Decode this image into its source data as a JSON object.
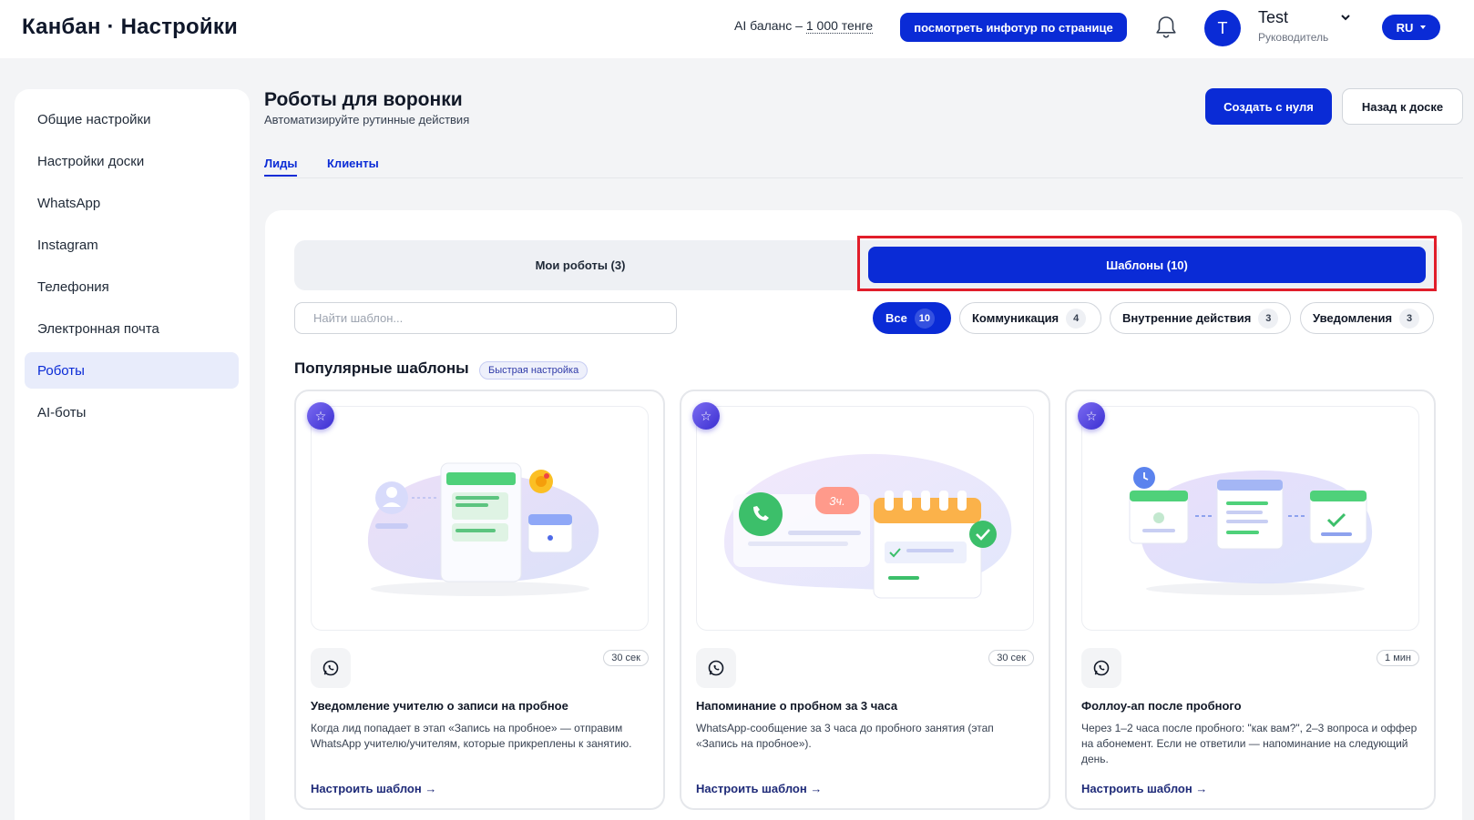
{
  "header": {
    "app_title": "Канбан · Настройки",
    "ai_balance_label": "AI баланс – ",
    "ai_balance_amount": "1 000 тенге",
    "tour_button": "посмотреть инфотур по странице",
    "avatar_letter": "T",
    "user_name": "Test",
    "user_role": "Руководитель",
    "language": "RU"
  },
  "sidebar": {
    "items": [
      {
        "label": "Общие настройки",
        "active": false
      },
      {
        "label": "Настройки доски",
        "active": false
      },
      {
        "label": "WhatsApp",
        "active": false
      },
      {
        "label": "Instagram",
        "active": false
      },
      {
        "label": "Телефония",
        "active": false
      },
      {
        "label": "Электронная почта",
        "active": false
      },
      {
        "label": "Роботы",
        "active": true
      },
      {
        "label": "AI-боты",
        "active": false
      }
    ]
  },
  "page": {
    "title": "Роботы для воронки",
    "subtitle": "Автоматизируйте рутинные действия",
    "create_button": "Создать с нуля",
    "back_button": "Назад к доске",
    "tabs": [
      {
        "label": "Лиды",
        "active": true
      },
      {
        "label": "Клиенты",
        "active": false
      }
    ]
  },
  "segment": {
    "my_robots": "Мои роботы (3)",
    "templates": "Шаблоны (10)",
    "selected": "templates"
  },
  "search": {
    "placeholder": "Найти шаблон...",
    "value": ""
  },
  "filters": [
    {
      "label": "Все",
      "count": "10",
      "active": true
    },
    {
      "label": "Коммуникация",
      "count": "4",
      "active": false
    },
    {
      "label": "Внутренние действия",
      "count": "3",
      "active": false
    },
    {
      "label": "Уведомления",
      "count": "3",
      "active": false
    }
  ],
  "popular": {
    "title": "Популярные шаблоны",
    "badge": "Быстрая настройка"
  },
  "cards": [
    {
      "icon": "whatsapp-icon",
      "time": "30 сек",
      "title": "Уведомление учителю о записи на пробное",
      "description": "Когда лид попадает в этап «Запись на пробное» — отправим WhatsApp учителю/учителям, которые прикреплены к занятию.",
      "link": "Настроить шаблон →"
    },
    {
      "icon": "whatsapp-icon",
      "time": "30 сек",
      "title": "Напоминание о пробном за 3 часа",
      "description": "WhatsApp-сообщение за 3 часа до пробного занятия (этап «Запись на пробное»).",
      "link": "Настроить шаблон →",
      "illustration_text": "3ч."
    },
    {
      "icon": "whatsapp-icon",
      "time": "1 мин",
      "title": "Фоллоу-ап после пробного",
      "description": "Через 1–2 часа после пробного: \"как вам?\", 2–3 вопроса и оффер на абонемент. Если не ответили — напоминание на следующий день.",
      "link": "Настроить шаблон →"
    }
  ],
  "colors": {
    "primary": "#0a2bd6",
    "highlight": "#e11d2a",
    "background": "#f3f4f6"
  }
}
